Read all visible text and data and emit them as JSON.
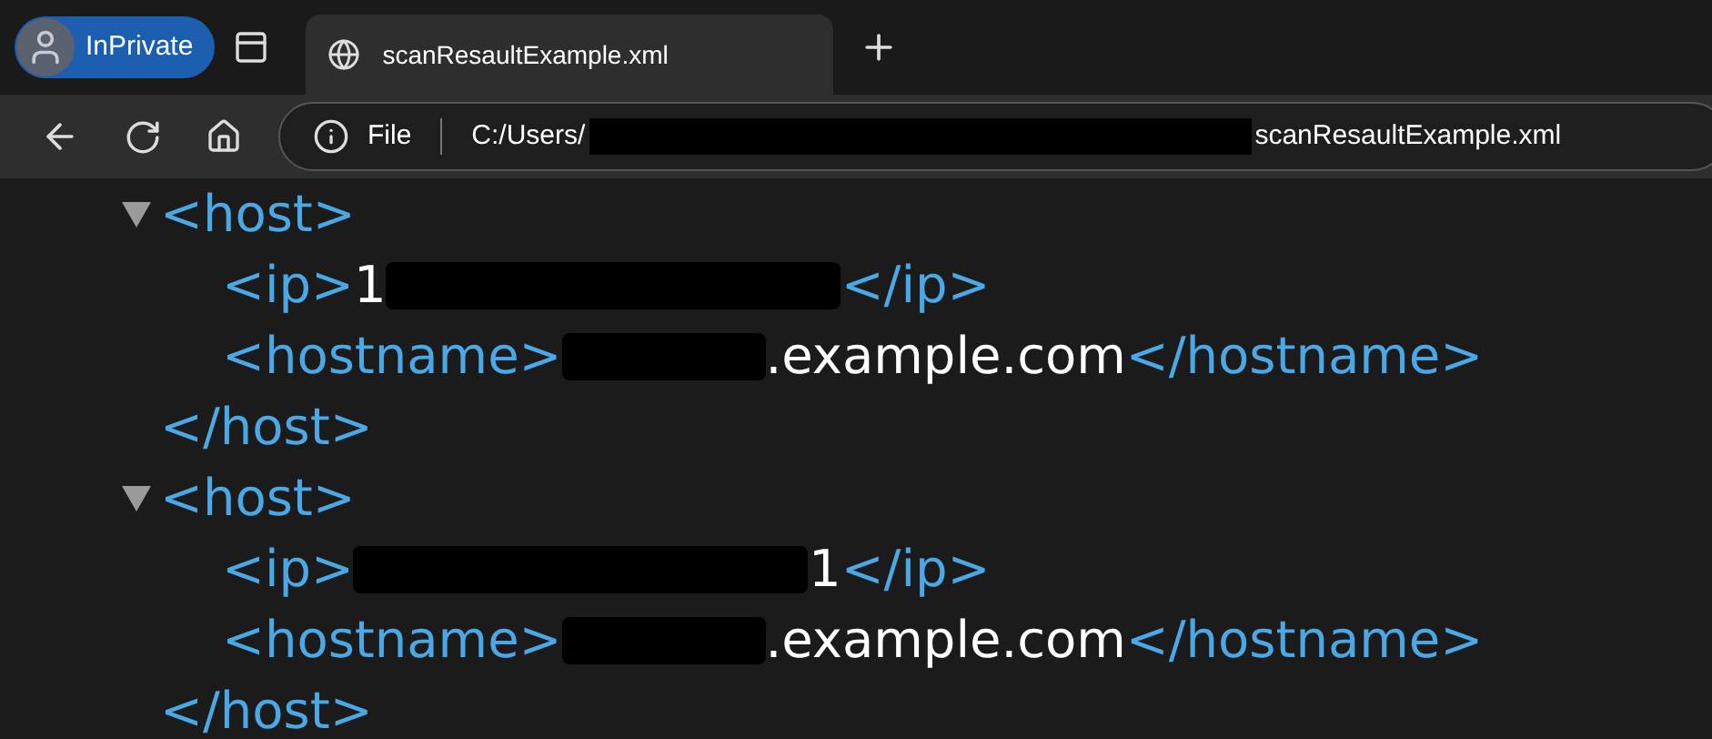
{
  "profile": {
    "label": "InPrivate"
  },
  "tab": {
    "title": "scanResaultExample.xml",
    "selected": true
  },
  "address": {
    "scheme_label": "File",
    "parts": [
      {
        "kind": "text",
        "text": "C:/Users/"
      },
      {
        "kind": "redacted"
      },
      {
        "kind": "text",
        "text": "scanResaultExample.xml"
      }
    ]
  },
  "xml": [
    {
      "open": "<host>",
      "expanded": true,
      "close": "</host>",
      "children": [
        {
          "open": "<ip>",
          "close": "</ip>",
          "parts": [
            {
              "kind": "text",
              "text": "1"
            },
            {
              "kind": "redacted"
            }
          ]
        },
        {
          "open": "<hostname>",
          "close": "</hostname>",
          "parts": [
            {
              "kind": "redacted"
            },
            {
              "kind": "text",
              "text": ".example.com"
            }
          ]
        }
      ]
    },
    {
      "open": "<host>",
      "expanded": true,
      "close": "</host>",
      "children": [
        {
          "open": "<ip>",
          "close": "</ip>",
          "parts": [
            {
              "kind": "redacted"
            },
            {
              "kind": "text",
              "text": "1"
            }
          ]
        },
        {
          "open": "<hostname>",
          "close": "</hostname>",
          "parts": [
            {
              "kind": "redacted"
            },
            {
              "kind": "text",
              "text": ".example.com"
            }
          ]
        }
      ]
    }
  ]
}
